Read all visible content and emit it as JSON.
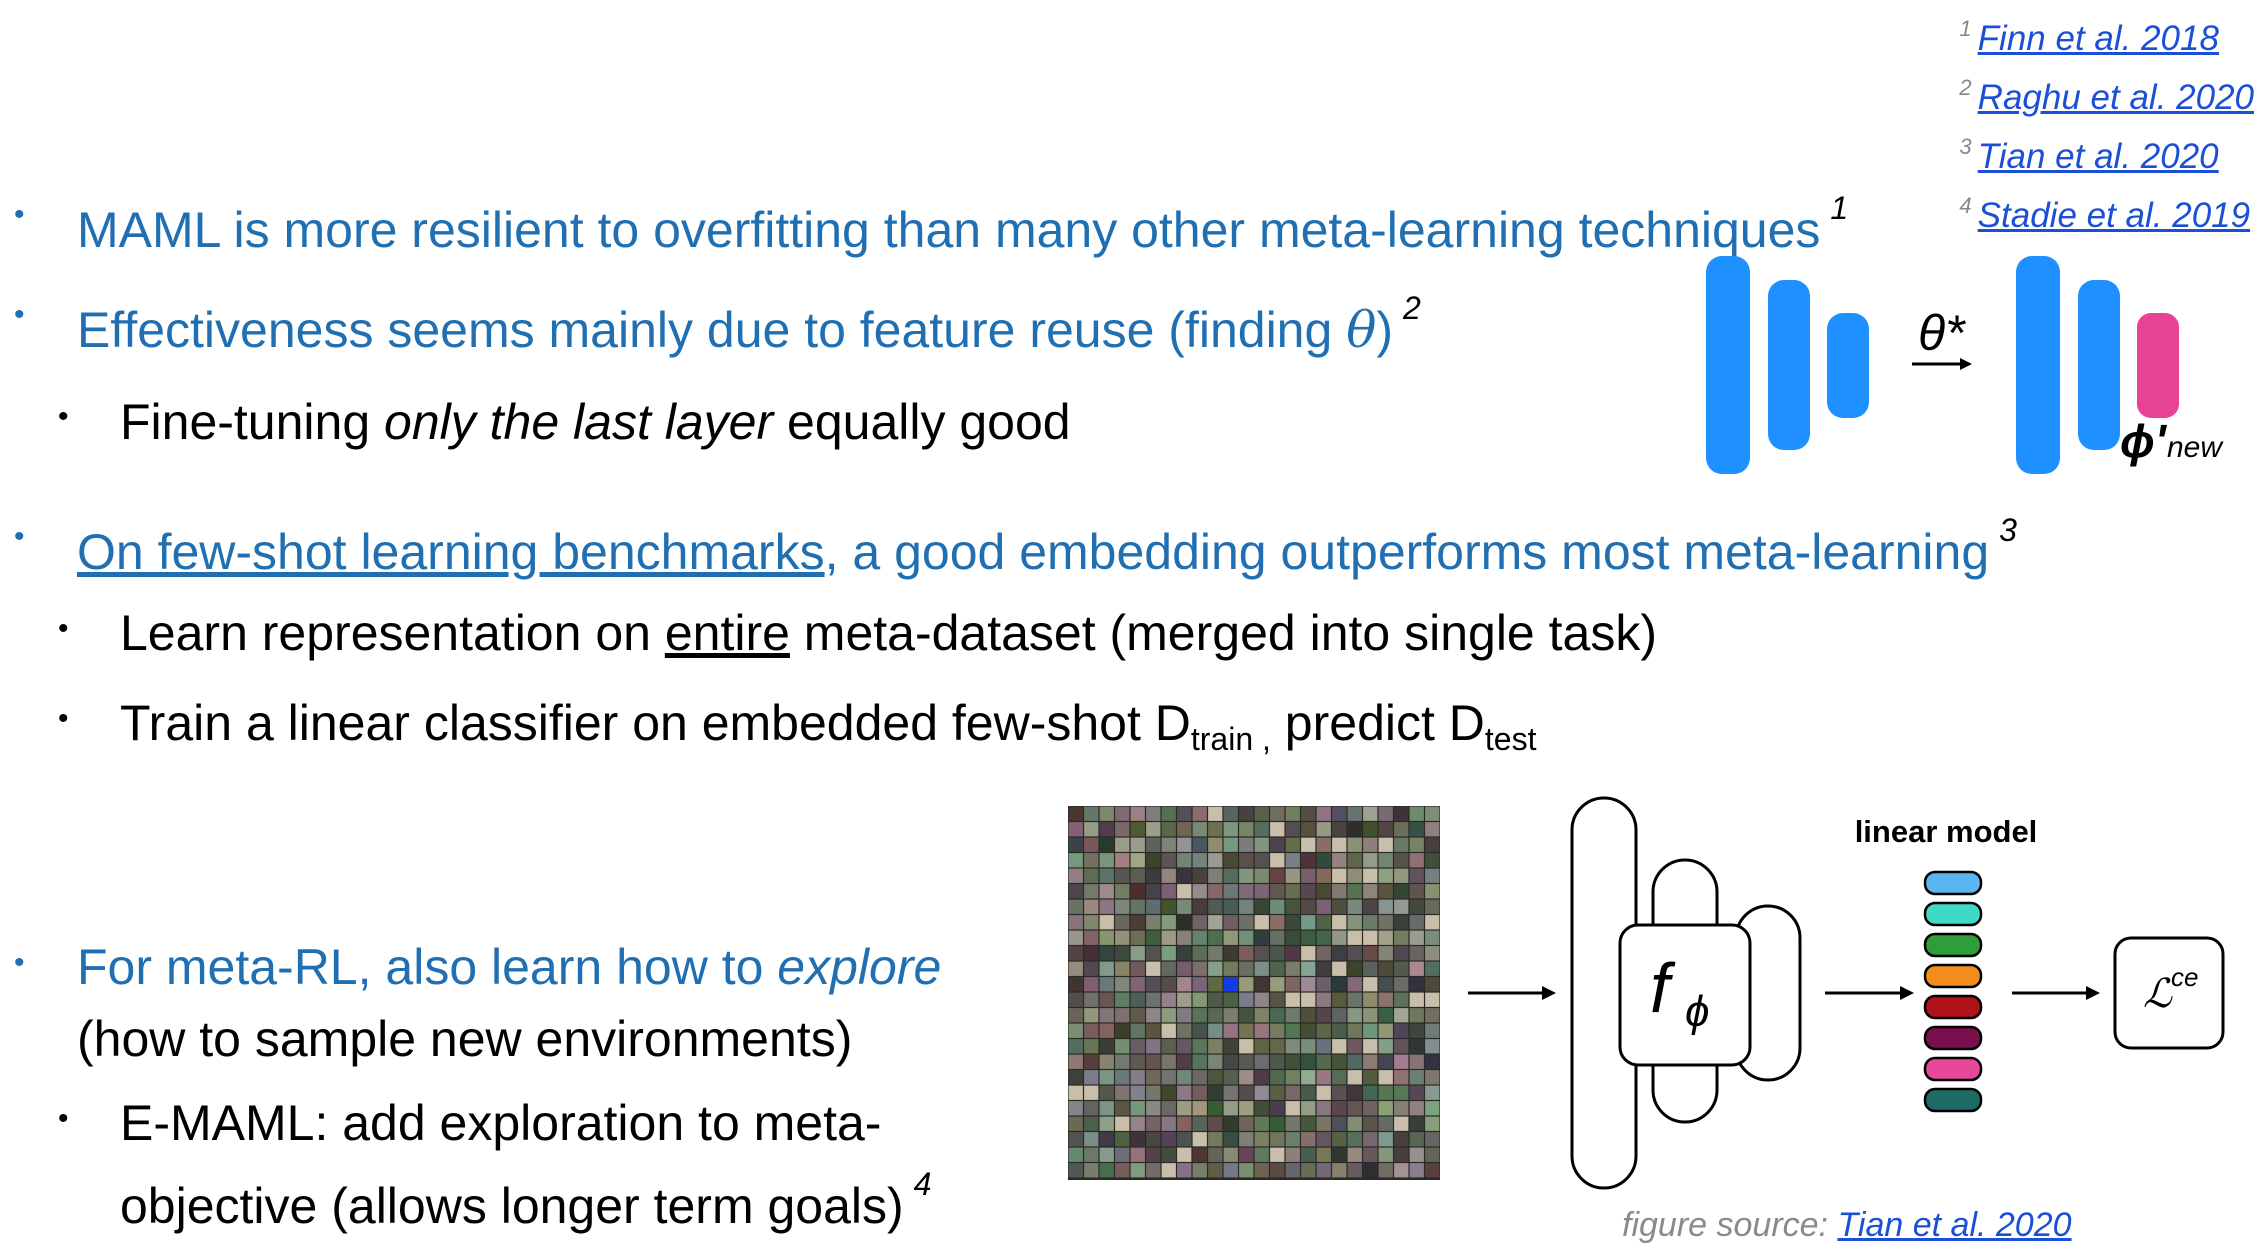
{
  "references": [
    {
      "num": "1",
      "text": "Finn et al. 2018"
    },
    {
      "num": "2",
      "text": "Raghu et al. 2020"
    },
    {
      "num": "3",
      "text": "Tian et al. 2020"
    },
    {
      "num": "4",
      "text": "Stadie et al. 2019"
    }
  ],
  "bullets": {
    "b1": {
      "text": "MAML is more resilient to overfitting than many other meta-learning techniques",
      "fn": "1"
    },
    "b2": {
      "text_before": "Effectiveness seems mainly due to feature reuse (finding ",
      "theta": "θ",
      "text_after": ")",
      "fn": "2"
    },
    "b2a": {
      "before": "Fine-tuning ",
      "italic": "only the last layer",
      "after": " equally good"
    },
    "b3": {
      "link": "On few-shot learning benchmarks",
      "text": ", a good embedding outperforms most meta-learning",
      "fn": "3"
    },
    "b3a": {
      "before": "Learn representation on ",
      "underline": "entire",
      "after": " meta-dataset (merged into single task)"
    },
    "b3b": {
      "before": "Train a linear classifier on embedded few-shot D",
      "sub1": "train ,",
      "mid": " predict D",
      "sub2": "test"
    },
    "b4": {
      "before": "For meta-RL, also learn how to ",
      "italic": "explore",
      "line2": "(how to sample new environments)"
    },
    "b4a": {
      "line1": "E-MAML: add exploration to meta-",
      "line2": "objective (allows longer term goals)",
      "fn": "4"
    }
  },
  "diagram_top": {
    "theta_label": "θ*",
    "phi_label": "ϕ'",
    "phi_sub": "new"
  },
  "diagram_bottom": {
    "f_label": "f",
    "f_sub": "ϕ",
    "linear_model_label": "linear model",
    "loss_label": "ℒ",
    "loss_sup": "ce",
    "source_prefix": "figure source: ",
    "source_link": "Tian et al. 2020",
    "embedding_colors": [
      "#5bb5f0",
      "#3fd9c4",
      "#2f9e3a",
      "#f28c1c",
      "#b0121b",
      "#7a0f4e",
      "#e6489a",
      "#1f6b66"
    ]
  },
  "colors": {
    "accent": "#1f6fb2",
    "network_blue": "#1e90ff",
    "pink": "#e84393"
  }
}
